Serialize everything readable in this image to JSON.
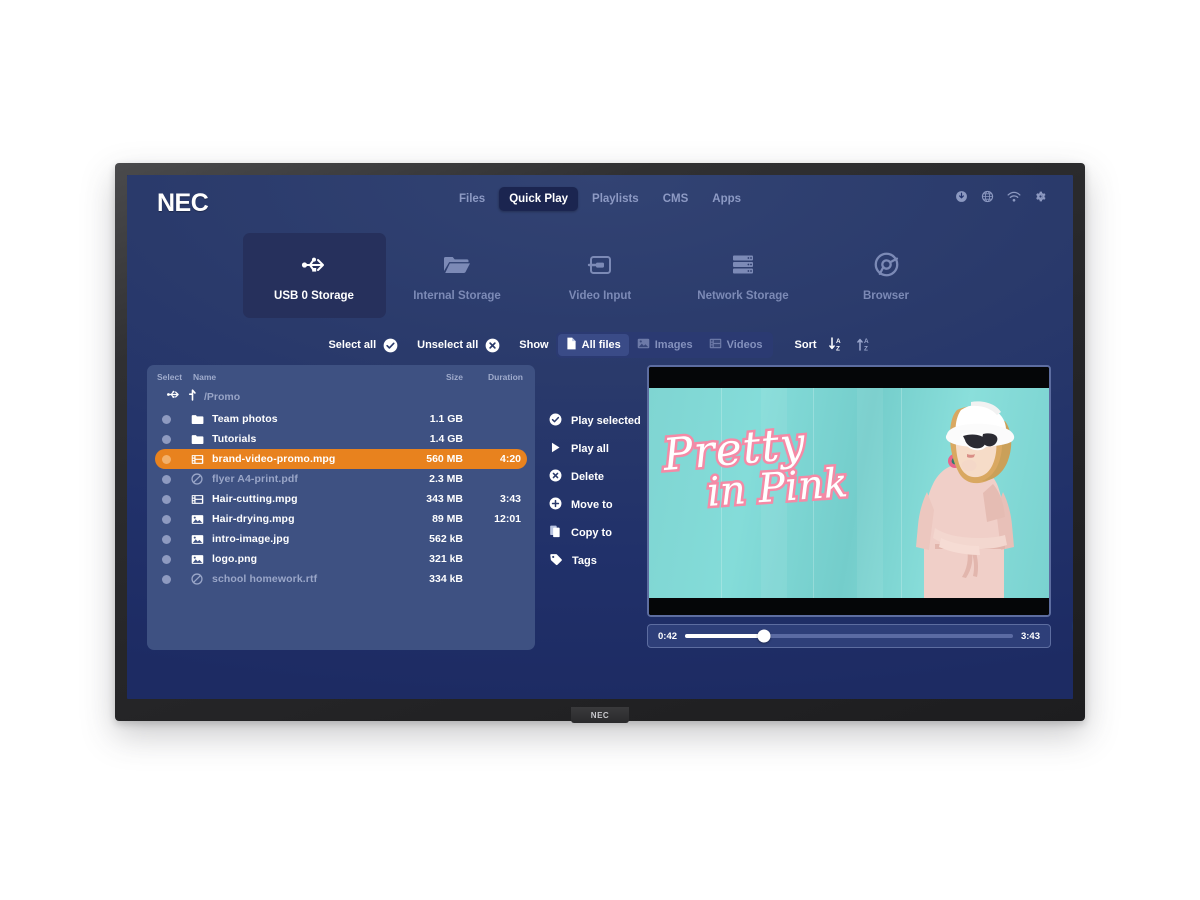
{
  "device": {
    "brand": "NEC",
    "bezel_logo": "NEC"
  },
  "header": {
    "logo": "NEC",
    "nav": [
      {
        "label": "Files",
        "active": false
      },
      {
        "label": "Quick Play",
        "active": true
      },
      {
        "label": "Playlists",
        "active": false
      },
      {
        "label": "CMS",
        "active": false
      },
      {
        "label": "Apps",
        "active": false
      }
    ],
    "system_icons": [
      "download-icon",
      "globe-icon",
      "wifi-icon",
      "gear-icon"
    ]
  },
  "sources": [
    {
      "label": "USB 0 Storage",
      "icon": "usb-icon",
      "active": true
    },
    {
      "label": "Internal Storage",
      "icon": "folder-icon",
      "active": false
    },
    {
      "label": "Video Input",
      "icon": "video-input-icon",
      "active": false
    },
    {
      "label": "Network Storage",
      "icon": "server-icon",
      "active": false
    },
    {
      "label": "Browser",
      "icon": "browser-icon",
      "active": false
    }
  ],
  "toolbar": {
    "select_all_label": "Select all",
    "select_all_icon": "check-circle-icon",
    "unselect_all_label": "Unselect all",
    "unselect_all_icon": "x-circle-icon",
    "show_label": "Show",
    "filters": [
      {
        "label": "All files",
        "icon": "document-icon",
        "active": true
      },
      {
        "label": "Images",
        "icon": "image-icon",
        "active": false
      },
      {
        "label": "Videos",
        "icon": "film-icon",
        "active": false
      }
    ],
    "sort_label": "Sort",
    "sort_desc_icon": "sort-descending-az-icon",
    "sort_asc_icon": "sort-ascending-az-icon"
  },
  "filelist": {
    "columns": {
      "select": "Select",
      "name": "Name",
      "size": "Size",
      "duration": "Duration"
    },
    "breadcrumb": {
      "device_icon": "usb-icon",
      "up_icon": "level-up-icon",
      "path": "/Promo"
    },
    "rows": [
      {
        "name": "Team photos",
        "size": "1.1 GB",
        "duration": "",
        "icon": "folder-icon",
        "selected": false,
        "disabled": false
      },
      {
        "name": "Tutorials",
        "size": "1.4 GB",
        "duration": "",
        "icon": "folder-icon",
        "selected": false,
        "disabled": false
      },
      {
        "name": "brand-video-promo.mpg",
        "size": "560 MB",
        "duration": "4:20",
        "icon": "film-icon",
        "selected": true,
        "disabled": false
      },
      {
        "name": "flyer A4-print.pdf",
        "size": "2.3 MB",
        "duration": "",
        "icon": "blocked-icon",
        "selected": false,
        "disabled": true
      },
      {
        "name": "Hair-cutting.mpg",
        "size": "343 MB",
        "duration": "3:43",
        "icon": "film-icon",
        "selected": false,
        "disabled": false
      },
      {
        "name": "Hair-drying.mpg",
        "size": "89 MB",
        "duration": "12:01",
        "icon": "image-icon",
        "selected": false,
        "disabled": false
      },
      {
        "name": "intro-image.jpg",
        "size": "562 kB",
        "duration": "",
        "icon": "image-icon",
        "selected": false,
        "disabled": false
      },
      {
        "name": "logo.png",
        "size": "321 kB",
        "duration": "",
        "icon": "image-icon",
        "selected": false,
        "disabled": false
      },
      {
        "name": "school homework.rtf",
        "size": "334 kB",
        "duration": "",
        "icon": "blocked-icon",
        "selected": false,
        "disabled": true
      }
    ]
  },
  "actions": [
    {
      "label": "Play selected",
      "icon": "check-circle-icon"
    },
    {
      "label": "Play all",
      "icon": "play-icon"
    },
    {
      "label": "Delete",
      "icon": "x-circle-icon"
    },
    {
      "label": "Move to",
      "icon": "plus-circle-icon"
    },
    {
      "label": "Copy to",
      "icon": "copy-icon"
    },
    {
      "label": "Tags",
      "icon": "tag-icon"
    }
  ],
  "preview": {
    "overlay_line1": "Pretty",
    "overlay_line2": "in Pink",
    "current_time": "0:42",
    "total_time": "3:43",
    "progress_percent": 24
  },
  "colors": {
    "background": "#22336d",
    "panel": "#3e5182",
    "accent_selected": "#e8821e",
    "nav_active_bg": "#1b2550",
    "tile_active_bg": "#26305c",
    "muted_text": "#8d9ac4",
    "video_teal": "#7fd5d2",
    "video_pink": "#f48aa6"
  }
}
